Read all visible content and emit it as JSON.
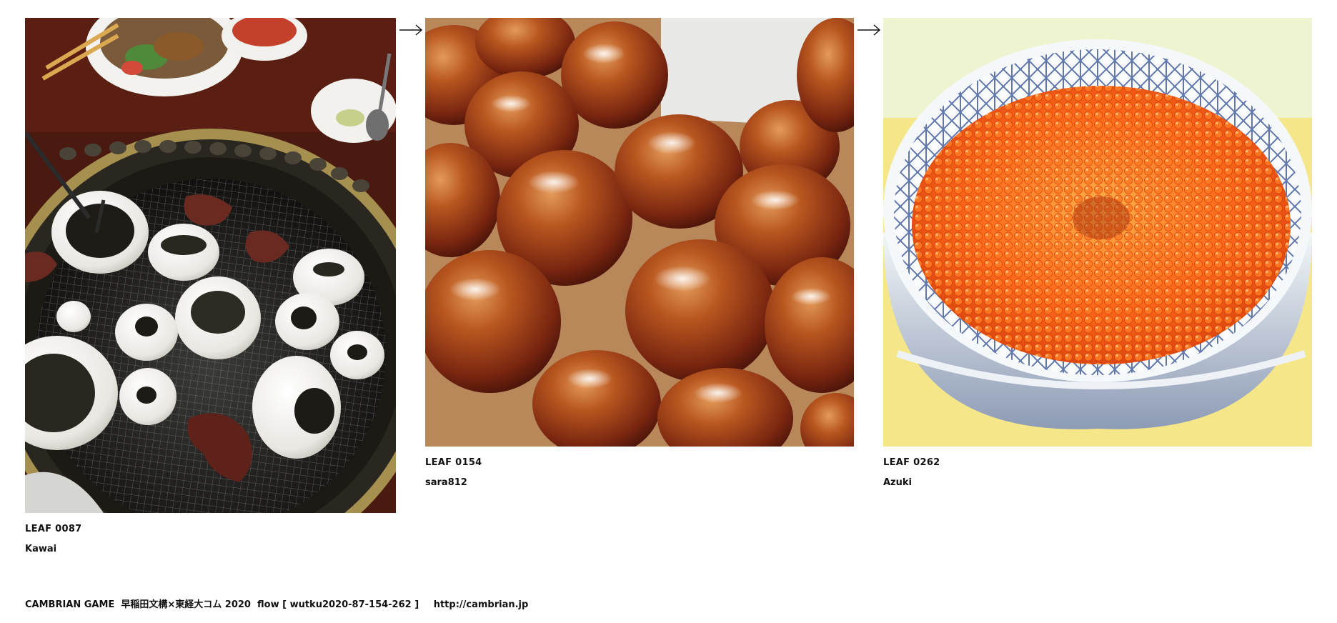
{
  "leaves": [
    {
      "id": "LEAF 0087",
      "author": "Kawai",
      "photo_subject": "yakiniku-grill-photo"
    },
    {
      "id": "LEAF 0154",
      "author": "sara812",
      "photo_subject": "glazed-eggs-photo"
    },
    {
      "id": "LEAF 0262",
      "author": "Azuki",
      "photo_subject": "ikura-don-photo"
    }
  ],
  "footer": {
    "flow_text": "CAMBRIAN GAME  早稲田文構×東経大コム 2020  flow [ wutku2020-87-154-262 ]",
    "link_text": "http://cambrian.jp"
  },
  "icons": {
    "arrow": "right-arrow-icon"
  },
  "colors": {
    "text": "#111111",
    "background": "#ffffff"
  }
}
